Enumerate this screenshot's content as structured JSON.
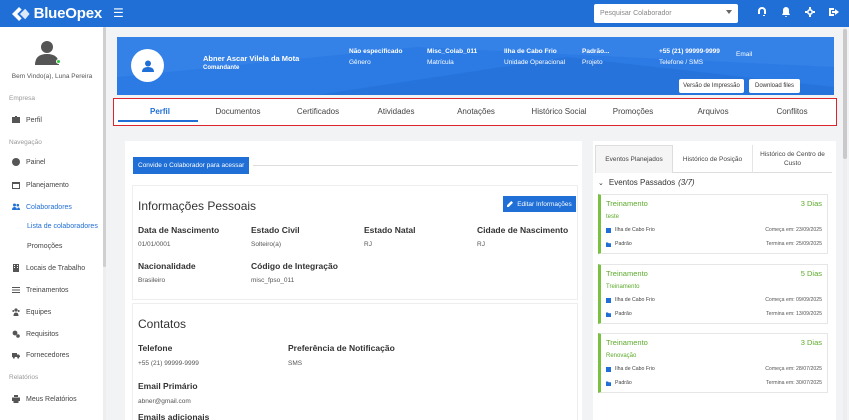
{
  "app": {
    "name": "BlueOpex"
  },
  "search": {
    "placeholder": "Pesquisar Colaborador"
  },
  "sidebar": {
    "welcome": "Bem Vindo(a), Luna Pereira",
    "sections": {
      "empresa": "Empresa",
      "navegacao": "Navegação",
      "relatorios": "Relatórios"
    },
    "items": {
      "perfil": "Perfil",
      "painel": "Painel",
      "planejamento": "Planejamento",
      "colaboradores": "Colaboradores",
      "lista": "Lista de colaboradores",
      "promocoes": "Promoções",
      "locais": "Locais de Trabalho",
      "treinamentos": "Treinamentos",
      "equipes": "Equipes",
      "requisitos": "Requisitos",
      "fornecedores": "Fornecedores",
      "meus_relatorios": "Meus Relatórios"
    }
  },
  "profile": {
    "name": "Abner Ascar Vilela da Mota",
    "role": "Comandante",
    "fields": {
      "genero": {
        "value": "Não especificado",
        "label": "Gênero"
      },
      "matricula": {
        "value": "Misc_Colab_011",
        "label": "Matrícula"
      },
      "unidade": {
        "value": "Ilha de Cabo Frio",
        "label": "Unidade Operacional"
      },
      "projeto": {
        "value": "Padrão...",
        "label": "Projeto"
      },
      "telefone": {
        "value": "+55 (21) 99999-9999",
        "label": "Telefone / SMS"
      },
      "email": {
        "value": "",
        "label": "Email"
      }
    },
    "buttons": {
      "print": "Versão de Impressão",
      "download": "Download files"
    }
  },
  "tabs": [
    "Perfil",
    "Documentos",
    "Certificados",
    "Atividades",
    "Anotações",
    "Histórico Social",
    "Promoções",
    "Arquivos",
    "Conflitos"
  ],
  "invite": {
    "label": "Convide o Colaborador para acessar"
  },
  "personal": {
    "title": "Informações Pessoais",
    "edit_label": "Editar Informações",
    "fields": {
      "nascimento": {
        "label": "Data de Nascimento",
        "value": "01/01/0001"
      },
      "civil": {
        "label": "Estado Civil",
        "value": "Solteiro(a)"
      },
      "natal": {
        "label": "Estado Natal",
        "value": "RJ"
      },
      "cidade": {
        "label": "Cidade de Nascimento",
        "value": "RJ"
      },
      "nacionalidade": {
        "label": "Nacionalidade",
        "value": "Brasileiro"
      },
      "codigo": {
        "label": "Código de Integração",
        "value": "misc_fpso_011"
      }
    }
  },
  "contacts": {
    "title": "Contatos",
    "telefone": {
      "label": "Telefone",
      "value": "+55 (21) 99999-9999"
    },
    "preferencia": {
      "label": "Preferência de Notificação",
      "value": "SMS"
    },
    "email": {
      "label": "Email Primário",
      "value": "abner@gmail.com"
    },
    "emails_adicionais": {
      "label": "Emails adicionais"
    }
  },
  "right": {
    "tabs": [
      "Eventos Planejados",
      "Histórico de Posição",
      "Histórico de Centro de Custo"
    ],
    "past_title": "Eventos Passados",
    "past_count": "(3/7)",
    "events": [
      {
        "type": "Treinamento",
        "days": "3 Dias",
        "sub": "teste",
        "place": "Ilha de Cabo Frio",
        "start": "Começa em: 23/09/2025",
        "project": "Padrão",
        "end": "Termina em: 25/09/2025"
      },
      {
        "type": "Treinamento",
        "days": "5 Dias",
        "sub": "Treinamento",
        "place": "Ilha de Cabo Frio",
        "start": "Começa em: 09/09/2025",
        "project": "Padrão",
        "end": "Termina em: 13/09/2025"
      },
      {
        "type": "Treinamento",
        "days": "3 Dias",
        "sub": "Renovação",
        "place": "Ilha de Cabo Frio",
        "start": "Começa em: 28/07/2025",
        "project": "Padrão",
        "end": "Termina em: 30/07/2025"
      }
    ]
  },
  "colors": {
    "primary": "#1f6fd6",
    "header": "#2c7be5",
    "success": "#5daa2c",
    "highlight": "#d9262c"
  }
}
